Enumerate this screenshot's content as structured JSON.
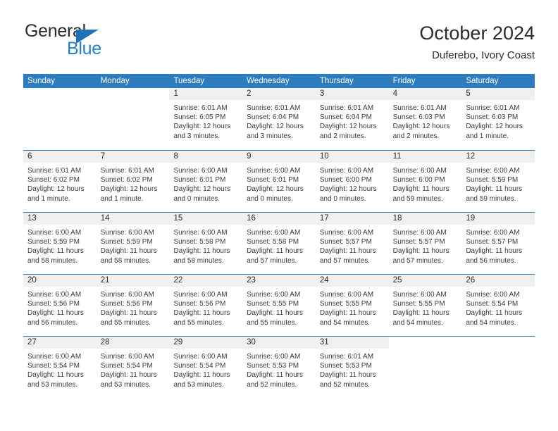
{
  "brand": {
    "name_top": "General",
    "name_bottom": "Blue",
    "triangle_color": "#1f71b8",
    "blue_color": "#1f82d0"
  },
  "header": {
    "title": "October 2024",
    "subtitle": "Duferebo, Ivory Coast"
  },
  "theme": {
    "header_blue": "#2d7cbf",
    "band_gray": "#f0f0f0",
    "text_dark": "#2b2b2b"
  },
  "calendar": {
    "weekdays": [
      "Sunday",
      "Monday",
      "Tuesday",
      "Wednesday",
      "Thursday",
      "Friday",
      "Saturday"
    ],
    "weeks": [
      [
        {
          "day": "",
          "lines": []
        },
        {
          "day": "",
          "lines": []
        },
        {
          "day": "1",
          "lines": [
            "Sunrise: 6:01 AM",
            "Sunset: 6:05 PM",
            "Daylight: 12 hours",
            "and 3 minutes."
          ]
        },
        {
          "day": "2",
          "lines": [
            "Sunrise: 6:01 AM",
            "Sunset: 6:04 PM",
            "Daylight: 12 hours",
            "and 3 minutes."
          ]
        },
        {
          "day": "3",
          "lines": [
            "Sunrise: 6:01 AM",
            "Sunset: 6:04 PM",
            "Daylight: 12 hours",
            "and 2 minutes."
          ]
        },
        {
          "day": "4",
          "lines": [
            "Sunrise: 6:01 AM",
            "Sunset: 6:03 PM",
            "Daylight: 12 hours",
            "and 2 minutes."
          ]
        },
        {
          "day": "5",
          "lines": [
            "Sunrise: 6:01 AM",
            "Sunset: 6:03 PM",
            "Daylight: 12 hours",
            "and 1 minute."
          ]
        }
      ],
      [
        {
          "day": "6",
          "lines": [
            "Sunrise: 6:01 AM",
            "Sunset: 6:02 PM",
            "Daylight: 12 hours",
            "and 1 minute."
          ]
        },
        {
          "day": "7",
          "lines": [
            "Sunrise: 6:01 AM",
            "Sunset: 6:02 PM",
            "Daylight: 12 hours",
            "and 1 minute."
          ]
        },
        {
          "day": "8",
          "lines": [
            "Sunrise: 6:00 AM",
            "Sunset: 6:01 PM",
            "Daylight: 12 hours",
            "and 0 minutes."
          ]
        },
        {
          "day": "9",
          "lines": [
            "Sunrise: 6:00 AM",
            "Sunset: 6:01 PM",
            "Daylight: 12 hours",
            "and 0 minutes."
          ]
        },
        {
          "day": "10",
          "lines": [
            "Sunrise: 6:00 AM",
            "Sunset: 6:00 PM",
            "Daylight: 12 hours",
            "and 0 minutes."
          ]
        },
        {
          "day": "11",
          "lines": [
            "Sunrise: 6:00 AM",
            "Sunset: 6:00 PM",
            "Daylight: 11 hours",
            "and 59 minutes."
          ]
        },
        {
          "day": "12",
          "lines": [
            "Sunrise: 6:00 AM",
            "Sunset: 5:59 PM",
            "Daylight: 11 hours",
            "and 59 minutes."
          ]
        }
      ],
      [
        {
          "day": "13",
          "lines": [
            "Sunrise: 6:00 AM",
            "Sunset: 5:59 PM",
            "Daylight: 11 hours",
            "and 58 minutes."
          ]
        },
        {
          "day": "14",
          "lines": [
            "Sunrise: 6:00 AM",
            "Sunset: 5:59 PM",
            "Daylight: 11 hours",
            "and 58 minutes."
          ]
        },
        {
          "day": "15",
          "lines": [
            "Sunrise: 6:00 AM",
            "Sunset: 5:58 PM",
            "Daylight: 11 hours",
            "and 58 minutes."
          ]
        },
        {
          "day": "16",
          "lines": [
            "Sunrise: 6:00 AM",
            "Sunset: 5:58 PM",
            "Daylight: 11 hours",
            "and 57 minutes."
          ]
        },
        {
          "day": "17",
          "lines": [
            "Sunrise: 6:00 AM",
            "Sunset: 5:57 PM",
            "Daylight: 11 hours",
            "and 57 minutes."
          ]
        },
        {
          "day": "18",
          "lines": [
            "Sunrise: 6:00 AM",
            "Sunset: 5:57 PM",
            "Daylight: 11 hours",
            "and 57 minutes."
          ]
        },
        {
          "day": "19",
          "lines": [
            "Sunrise: 6:00 AM",
            "Sunset: 5:57 PM",
            "Daylight: 11 hours",
            "and 56 minutes."
          ]
        }
      ],
      [
        {
          "day": "20",
          "lines": [
            "Sunrise: 6:00 AM",
            "Sunset: 5:56 PM",
            "Daylight: 11 hours",
            "and 56 minutes."
          ]
        },
        {
          "day": "21",
          "lines": [
            "Sunrise: 6:00 AM",
            "Sunset: 5:56 PM",
            "Daylight: 11 hours",
            "and 55 minutes."
          ]
        },
        {
          "day": "22",
          "lines": [
            "Sunrise: 6:00 AM",
            "Sunset: 5:56 PM",
            "Daylight: 11 hours",
            "and 55 minutes."
          ]
        },
        {
          "day": "23",
          "lines": [
            "Sunrise: 6:00 AM",
            "Sunset: 5:55 PM",
            "Daylight: 11 hours",
            "and 55 minutes."
          ]
        },
        {
          "day": "24",
          "lines": [
            "Sunrise: 6:00 AM",
            "Sunset: 5:55 PM",
            "Daylight: 11 hours",
            "and 54 minutes."
          ]
        },
        {
          "day": "25",
          "lines": [
            "Sunrise: 6:00 AM",
            "Sunset: 5:55 PM",
            "Daylight: 11 hours",
            "and 54 minutes."
          ]
        },
        {
          "day": "26",
          "lines": [
            "Sunrise: 6:00 AM",
            "Sunset: 5:54 PM",
            "Daylight: 11 hours",
            "and 54 minutes."
          ]
        }
      ],
      [
        {
          "day": "27",
          "lines": [
            "Sunrise: 6:00 AM",
            "Sunset: 5:54 PM",
            "Daylight: 11 hours",
            "and 53 minutes."
          ]
        },
        {
          "day": "28",
          "lines": [
            "Sunrise: 6:00 AM",
            "Sunset: 5:54 PM",
            "Daylight: 11 hours",
            "and 53 minutes."
          ]
        },
        {
          "day": "29",
          "lines": [
            "Sunrise: 6:00 AM",
            "Sunset: 5:54 PM",
            "Daylight: 11 hours",
            "and 53 minutes."
          ]
        },
        {
          "day": "30",
          "lines": [
            "Sunrise: 6:00 AM",
            "Sunset: 5:53 PM",
            "Daylight: 11 hours",
            "and 52 minutes."
          ]
        },
        {
          "day": "31",
          "lines": [
            "Sunrise: 6:01 AM",
            "Sunset: 5:53 PM",
            "Daylight: 11 hours",
            "and 52 minutes."
          ]
        },
        {
          "day": "",
          "lines": []
        },
        {
          "day": "",
          "lines": []
        }
      ]
    ]
  }
}
